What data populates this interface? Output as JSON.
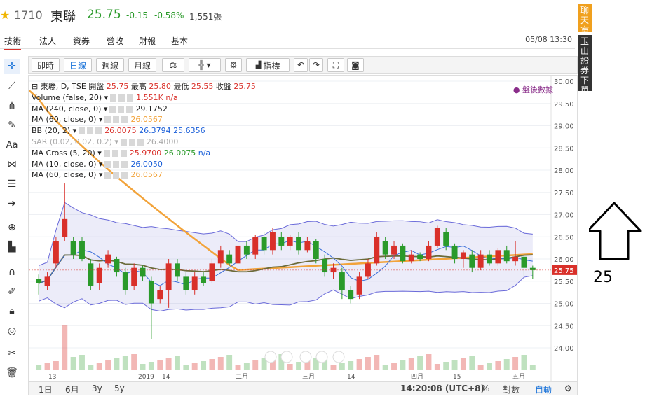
{
  "header": {
    "code": "1710",
    "name": "東聯",
    "price": "25.75",
    "change": "-0.15",
    "change_pct": "-0.58%",
    "volume": "1,551張"
  },
  "tabs": [
    "技術",
    "法人",
    "資券",
    "營收",
    "財報",
    "基本"
  ],
  "timestamp": "05/08 13:30",
  "toolbar": {
    "intraday": "即時",
    "daily": "日線",
    "weekly": "週線",
    "monthly": "月線",
    "indicators": "指標"
  },
  "indicators": [
    {
      "text": "東聯, D, TSE",
      "extra": [
        {
          "t": "開盤",
          "c": "dark"
        },
        {
          "t": "25.75",
          "c": "red"
        },
        {
          "t": "最高",
          "c": "dark"
        },
        {
          "t": "25.80",
          "c": "red"
        },
        {
          "t": "最低",
          "c": "dark"
        },
        {
          "t": "25.55",
          "c": "red"
        },
        {
          "t": "收盤",
          "c": "dark"
        },
        {
          "t": "25.75",
          "c": "red"
        }
      ]
    },
    {
      "text": "Volume (false, 20)",
      "extra": [
        {
          "t": "1.551K",
          "c": "red"
        },
        {
          "t": "n/a",
          "c": "red"
        }
      ]
    },
    {
      "text": "MA (240, close, 0)",
      "extra": [
        {
          "t": "29.1752",
          "c": "dark"
        }
      ]
    },
    {
      "text": "MA (60, close, 0)",
      "extra": [
        {
          "t": "26.0567",
          "c": "orange"
        }
      ]
    },
    {
      "text": "BB (20, 2)",
      "extra": [
        {
          "t": "26.0075",
          "c": "red"
        },
        {
          "t": "26.3794",
          "c": "blue"
        },
        {
          "t": "25.6356",
          "c": "blue"
        }
      ]
    },
    {
      "text": "SAR (0.02, 0.02, 0.2)",
      "dim": true,
      "extra": [
        {
          "t": "26.4000",
          "c": "grey"
        }
      ]
    },
    {
      "text": "MA Cross (5, 20)",
      "extra": [
        {
          "t": "25.9700",
          "c": "red"
        },
        {
          "t": "26.0075",
          "c": "green"
        },
        {
          "t": "n/a",
          "c": "blue"
        }
      ]
    },
    {
      "text": "MA (10, close, 0)",
      "extra": [
        {
          "t": "26.0050",
          "c": "blue"
        }
      ]
    },
    {
      "text": "MA (60, close, 0)",
      "extra": [
        {
          "t": "26.0567",
          "c": "orange"
        }
      ]
    }
  ],
  "after_hours": "盤後數據",
  "price_axis": [
    "30.00",
    "29.50",
    "29.00",
    "28.50",
    "28.00",
    "27.50",
    "27.00",
    "26.50",
    "26.00",
    "25.75",
    "25.50",
    "25.00",
    "24.50",
    "24.00"
  ],
  "last_price_tag": "25.75",
  "time_axis": [
    "13",
    "2019",
    "14",
    "二月",
    "三月",
    "14",
    "四月",
    "15",
    "五月"
  ],
  "cursor_time": "14:20:08 (UTC+8)",
  "bottom": {
    "ranges": [
      "1日",
      "6月",
      "3y",
      "5y"
    ],
    "percent": "%",
    "log": "對數",
    "auto": "自動"
  },
  "side": {
    "chat": "聊天室",
    "broker": "玉山證券下單"
  },
  "annotation": {
    "number": "25"
  },
  "colors": {
    "up": "#d9302a",
    "down": "#2a9a2a",
    "bb": "#6a6ad9",
    "ma60": "#f2a33a",
    "ma20": "#6b6b3a"
  },
  "chart_data": {
    "type": "candlestick",
    "y_range": [
      23.5,
      30.0
    ],
    "candles": [
      {
        "o": 25.55,
        "c": 25.45,
        "h": 25.65,
        "l": 25.2
      },
      {
        "o": 25.4,
        "c": 25.6,
        "h": 25.7,
        "l": 25.3
      },
      {
        "o": 25.9,
        "c": 26.4,
        "h": 26.5,
        "l": 25.8
      },
      {
        "o": 26.5,
        "c": 26.9,
        "h": 27.7,
        "l": 26.4
      },
      {
        "o": 26.4,
        "c": 26.1,
        "h": 26.5,
        "l": 26.0
      },
      {
        "o": 26.4,
        "c": 26.0,
        "h": 26.5,
        "l": 25.95
      },
      {
        "o": 25.9,
        "c": 25.4,
        "h": 26.0,
        "l": 25.3
      },
      {
        "o": 25.45,
        "c": 25.8,
        "h": 25.9,
        "l": 25.3
      },
      {
        "o": 25.9,
        "c": 26.1,
        "h": 26.2,
        "l": 25.8
      },
      {
        "o": 26.0,
        "c": 25.7,
        "h": 26.05,
        "l": 25.6
      },
      {
        "o": 25.7,
        "c": 25.3,
        "h": 25.8,
        "l": 25.2
      },
      {
        "o": 25.4,
        "c": 25.8,
        "h": 25.9,
        "l": 25.3
      },
      {
        "o": 25.8,
        "c": 25.6,
        "h": 25.85,
        "l": 25.5
      },
      {
        "o": 25.5,
        "c": 25.0,
        "h": 25.6,
        "l": 24.2
      },
      {
        "o": 25.1,
        "c": 25.3,
        "h": 25.4,
        "l": 25.0
      },
      {
        "o": 25.3,
        "c": 25.9,
        "h": 26.0,
        "l": 24.9
      },
      {
        "o": 25.9,
        "c": 25.6,
        "h": 26.0,
        "l": 25.5
      },
      {
        "o": 25.6,
        "c": 25.3,
        "h": 25.7,
        "l": 25.2
      },
      {
        "o": 25.3,
        "c": 25.6,
        "h": 25.7,
        "l": 25.2
      },
      {
        "o": 25.6,
        "c": 25.45,
        "h": 25.7,
        "l": 25.4
      },
      {
        "o": 25.5,
        "c": 25.9,
        "h": 26.0,
        "l": 25.45
      },
      {
        "o": 25.9,
        "c": 26.2,
        "h": 26.3,
        "l": 25.8
      },
      {
        "o": 26.1,
        "c": 25.9,
        "h": 26.2,
        "l": 25.85
      },
      {
        "o": 25.9,
        "c": 26.3,
        "h": 26.4,
        "l": 25.85
      },
      {
        "o": 26.3,
        "c": 26.1,
        "h": 26.4,
        "l": 26.0
      },
      {
        "o": 26.1,
        "c": 26.5,
        "h": 26.55,
        "l": 26.0
      },
      {
        "o": 26.5,
        "c": 26.2,
        "h": 26.6,
        "l": 26.1
      },
      {
        "o": 26.2,
        "c": 26.6,
        "h": 26.7,
        "l": 26.1
      },
      {
        "o": 26.5,
        "c": 26.3,
        "h": 26.6,
        "l": 26.2
      },
      {
        "o": 26.3,
        "c": 26.5,
        "h": 26.55,
        "l": 26.2
      },
      {
        "o": 26.5,
        "c": 26.2,
        "h": 26.6,
        "l": 26.1
      },
      {
        "o": 26.2,
        "c": 26.4,
        "h": 26.5,
        "l": 26.15
      },
      {
        "o": 26.4,
        "c": 26.0,
        "h": 26.45,
        "l": 25.9
      },
      {
        "o": 26.0,
        "c": 25.7,
        "h": 26.1,
        "l": 25.6
      },
      {
        "o": 25.7,
        "c": 25.8,
        "h": 25.9,
        "l": 25.55
      },
      {
        "o": 25.7,
        "c": 25.3,
        "h": 25.8,
        "l": 25.1
      },
      {
        "o": 25.3,
        "c": 25.1,
        "h": 25.4,
        "l": 25.0
      },
      {
        "o": 25.2,
        "c": 25.6,
        "h": 25.7,
        "l": 25.1
      },
      {
        "o": 25.6,
        "c": 25.9,
        "h": 26.0,
        "l": 25.55
      },
      {
        "o": 25.9,
        "c": 26.5,
        "h": 26.6,
        "l": 25.85
      },
      {
        "o": 26.4,
        "c": 26.1,
        "h": 26.5,
        "l": 26.0
      },
      {
        "o": 26.1,
        "c": 26.3,
        "h": 26.4,
        "l": 26.0
      },
      {
        "o": 26.3,
        "c": 25.95,
        "h": 26.35,
        "l": 25.9
      },
      {
        "o": 25.95,
        "c": 26.1,
        "h": 26.2,
        "l": 25.9
      },
      {
        "o": 26.1,
        "c": 26.0,
        "h": 26.15,
        "l": 25.95
      },
      {
        "o": 26.0,
        "c": 26.3,
        "h": 26.4,
        "l": 25.95
      },
      {
        "o": 26.3,
        "c": 26.7,
        "h": 26.75,
        "l": 26.25
      },
      {
        "o": 26.6,
        "c": 26.3,
        "h": 26.7,
        "l": 26.2
      },
      {
        "o": 26.3,
        "c": 26.0,
        "h": 26.35,
        "l": 25.9
      },
      {
        "o": 26.0,
        "c": 26.15,
        "h": 26.2,
        "l": 25.8
      },
      {
        "o": 26.1,
        "c": 25.8,
        "h": 26.2,
        "l": 25.7
      },
      {
        "o": 25.8,
        "c": 26.1,
        "h": 26.2,
        "l": 25.75
      },
      {
        "o": 26.1,
        "c": 25.9,
        "h": 26.2,
        "l": 25.85
      },
      {
        "o": 25.9,
        "c": 26.2,
        "h": 26.25,
        "l": 25.85
      },
      {
        "o": 26.2,
        "c": 25.95,
        "h": 26.3,
        "l": 25.9
      },
      {
        "o": 25.95,
        "c": 26.05,
        "h": 26.4,
        "l": 25.85
      },
      {
        "o": 26.05,
        "c": 25.8,
        "h": 26.1,
        "l": 25.6
      },
      {
        "o": 25.8,
        "c": 25.75,
        "h": 25.85,
        "l": 25.55
      }
    ]
  }
}
